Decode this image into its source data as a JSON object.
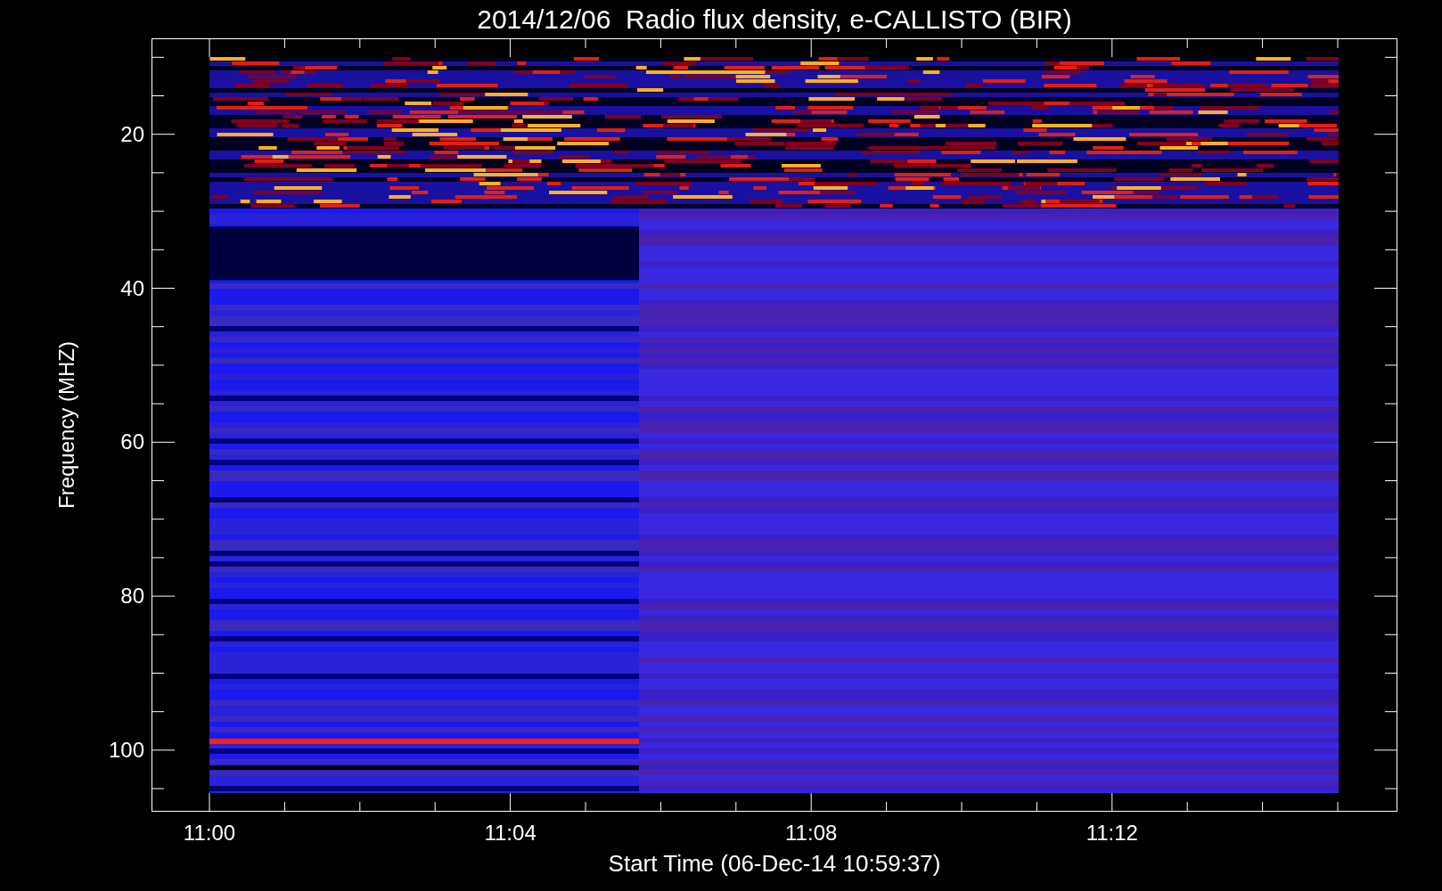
{
  "title": "2014/12/06  Radio flux density, e-CALLISTO (BIR)",
  "y_axis": {
    "label": "Frequency (MHZ)",
    "ticks": [
      "20",
      "40",
      "60",
      "80",
      "100"
    ]
  },
  "x_axis": {
    "label": "Start Time (06-Dec-14 10:59:37)",
    "ticks": [
      "11:00",
      "11:04",
      "11:08",
      "11:12"
    ]
  }
}
